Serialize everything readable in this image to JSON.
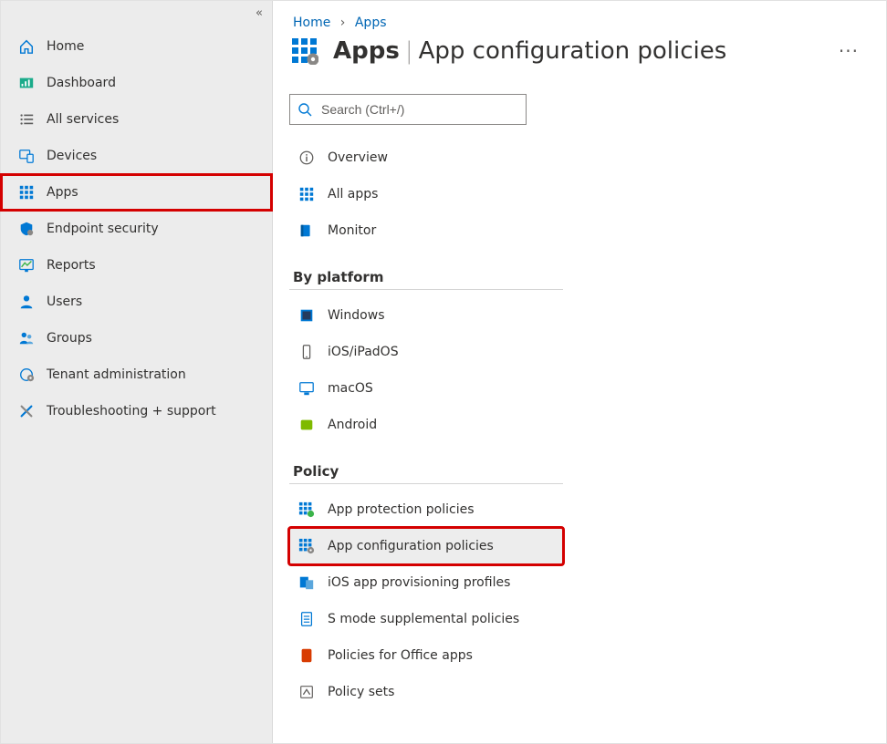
{
  "breadcrumb": {
    "home": "Home",
    "apps": "Apps"
  },
  "page": {
    "title_bold": "Apps",
    "title_light": "App configuration policies"
  },
  "search": {
    "placeholder": "Search (Ctrl+/)"
  },
  "sidebar": [
    {
      "label": "Home",
      "icon": "home-icon"
    },
    {
      "label": "Dashboard",
      "icon": "dashboard-icon"
    },
    {
      "label": "All services",
      "icon": "list-icon"
    },
    {
      "label": "Devices",
      "icon": "devices-icon"
    },
    {
      "label": "Apps",
      "icon": "apps-icon",
      "highlight": true
    },
    {
      "label": "Endpoint security",
      "icon": "shield-icon"
    },
    {
      "label": "Reports",
      "icon": "reports-icon"
    },
    {
      "label": "Users",
      "icon": "user-icon"
    },
    {
      "label": "Groups",
      "icon": "groups-icon"
    },
    {
      "label": "Tenant administration",
      "icon": "tenant-icon"
    },
    {
      "label": "Troubleshooting + support",
      "icon": "tools-icon"
    }
  ],
  "subnav": {
    "top": [
      {
        "label": "Overview",
        "icon": "info-icon"
      },
      {
        "label": "All apps",
        "icon": "apps-icon"
      },
      {
        "label": "Monitor",
        "icon": "monitor-book-icon"
      }
    ],
    "by_platform_label": "By platform",
    "by_platform": [
      {
        "label": "Windows",
        "icon": "windows-icon"
      },
      {
        "label": "iOS/iPadOS",
        "icon": "phone-icon"
      },
      {
        "label": "macOS",
        "icon": "mac-monitor-icon"
      },
      {
        "label": "Android",
        "icon": "android-icon"
      }
    ],
    "policy_label": "Policy",
    "policy": [
      {
        "label": "App protection policies",
        "icon": "apps-shield-icon"
      },
      {
        "label": "App configuration policies",
        "icon": "apps-gear-icon",
        "selected": true,
        "highlight": true
      },
      {
        "label": "iOS app provisioning profiles",
        "icon": "provisioning-icon"
      },
      {
        "label": "S mode supplemental policies",
        "icon": "document-icon"
      },
      {
        "label": "Policies for Office apps",
        "icon": "office-icon"
      },
      {
        "label": "Policy sets",
        "icon": "policy-sets-icon"
      }
    ]
  }
}
